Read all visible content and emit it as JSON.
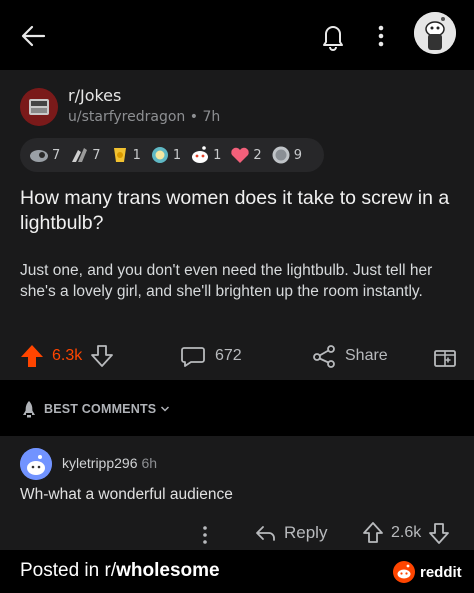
{
  "post": {
    "subreddit": "r/Jokes",
    "author_meta": "u/starfyredragon • 7h",
    "awards": [
      {
        "icon": "rocket-award-icon",
        "count": "7"
      },
      {
        "icon": "hands-award-icon",
        "count": "7"
      },
      {
        "icon": "gold-award-icon",
        "count": "1"
      },
      {
        "icon": "laurel-award-icon",
        "count": "1"
      },
      {
        "icon": "snoo-award-icon",
        "count": "1"
      },
      {
        "icon": "heart-award-icon",
        "count": "2"
      },
      {
        "icon": "silver-award-icon",
        "count": "9"
      }
    ],
    "title": "How many trans women does it take to screw in a lightbulb?",
    "body": "Just one, and you don't even need the lightbulb. Just tell her she's a lovely girl, and she'll brighten up the room instantly.",
    "score": "6.3k",
    "comments_count": "672",
    "share_label": "Share"
  },
  "sort": {
    "label": "BEST COMMENTS"
  },
  "comment": {
    "author": "kyletripp296",
    "time": "6h",
    "body": "Wh-what a wonderful audience",
    "reply_label": "Reply",
    "score": "2.6k"
  },
  "footer": {
    "prefix": "Posted in r/",
    "subreddit": "wholesome",
    "brand": "reddit"
  },
  "colors": {
    "upvote": "#ff4500",
    "background": "#000000",
    "card": "#1a1a1b"
  }
}
